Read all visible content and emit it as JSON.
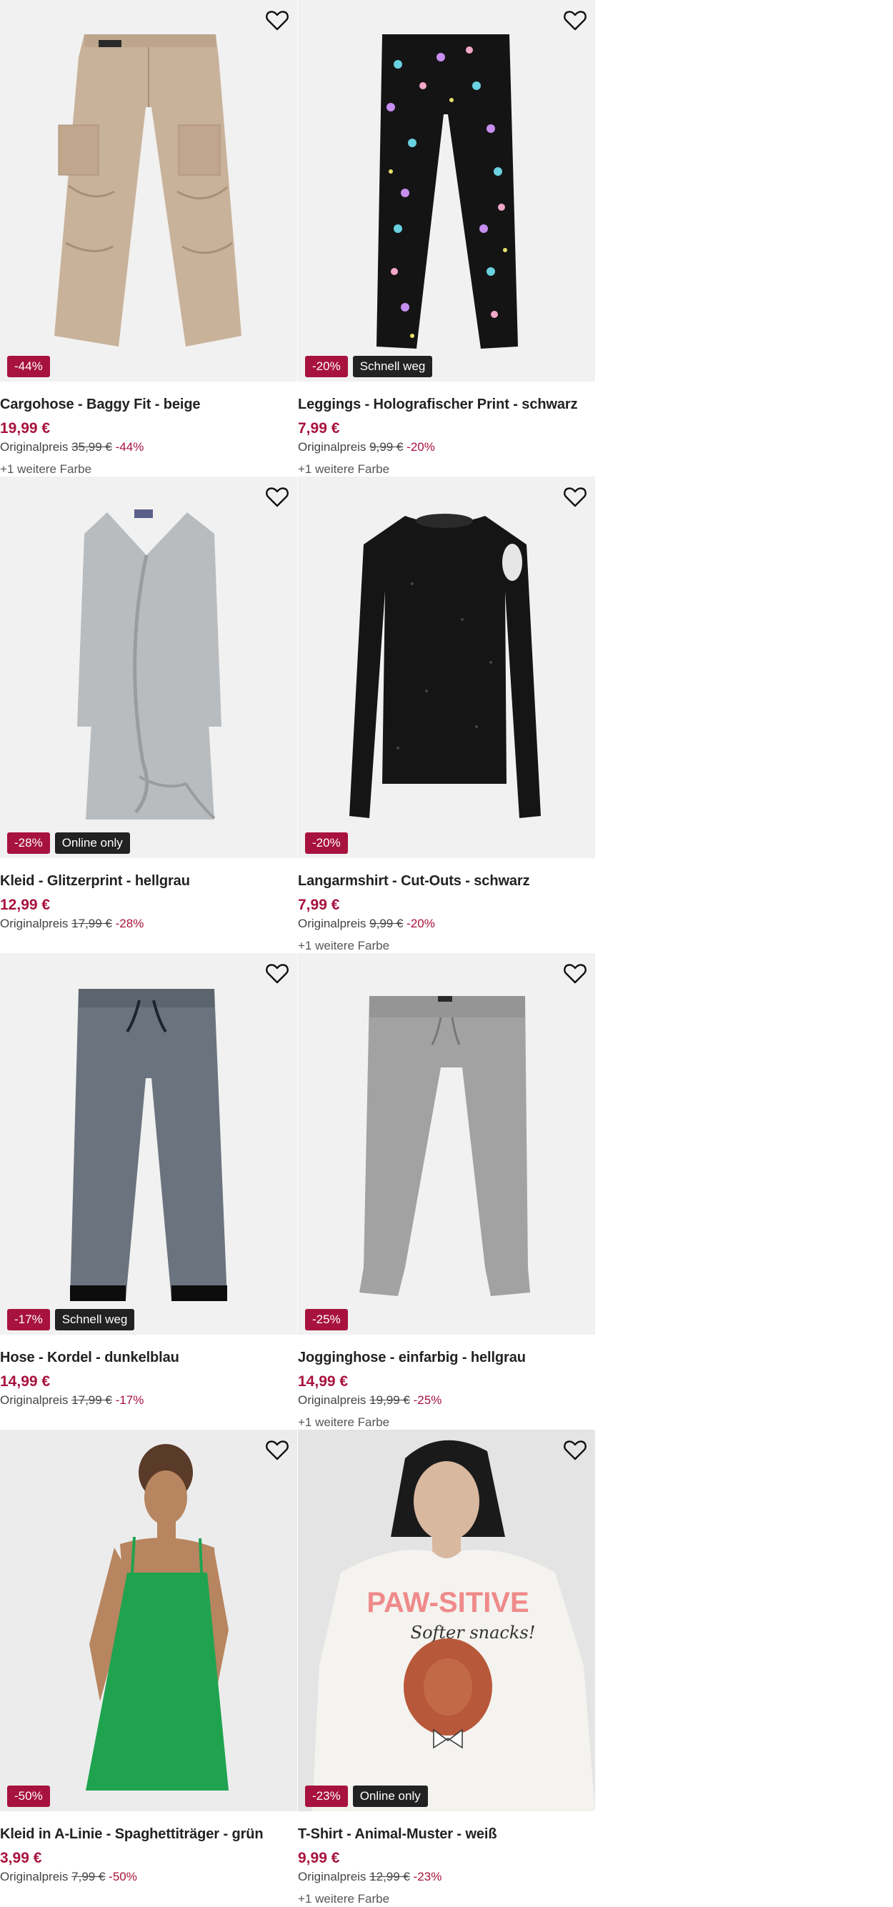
{
  "products": [
    {
      "title": "Cargohose - Baggy Fit - beige",
      "price": "19,99 €",
      "orig_label": "Originalpreis",
      "orig_price": "35,99 €",
      "orig_discount": "-44%",
      "badges": [
        "-44%"
      ],
      "more_colors": "+1 weitere Farbe",
      "art": "cargo-pants"
    },
    {
      "title": "Leggings - Holografischer Print - schwarz",
      "price": "7,99 €",
      "orig_label": "Originalpreis",
      "orig_price": "9,99 €",
      "orig_discount": "-20%",
      "badges": [
        "-20%",
        "Schnell weg"
      ],
      "more_colors": "+1 weitere Farbe",
      "art": "leggings"
    },
    {
      "title": "Kleid - Glitzerprint - hellgrau",
      "price": "12,99 €",
      "orig_label": "Originalpreis",
      "orig_price": "17,99 €",
      "orig_discount": "-28%",
      "badges": [
        "-28%",
        "Online only"
      ],
      "more_colors": "",
      "art": "wrap-dress"
    },
    {
      "title": "Langarmshirt - Cut-Outs - schwarz",
      "price": "7,99 €",
      "orig_label": "Originalpreis",
      "orig_price": "9,99 €",
      "orig_discount": "-20%",
      "badges": [
        "-20%"
      ],
      "more_colors": "+1 weitere Farbe",
      "art": "longsleeve"
    },
    {
      "title": "Hose - Kordel - dunkelblau",
      "price": "14,99 €",
      "orig_label": "Originalpreis",
      "orig_price": "17,99 €",
      "orig_discount": "-17%",
      "badges": [
        "-17%",
        "Schnell weg"
      ],
      "more_colors": "",
      "art": "lined-pants"
    },
    {
      "title": "Jogginghose - einfarbig - hellgrau",
      "price": "14,99 €",
      "orig_label": "Originalpreis",
      "orig_price": "19,99 €",
      "orig_discount": "-25%",
      "badges": [
        "-25%"
      ],
      "more_colors": "+1 weitere Farbe",
      "art": "joggers"
    },
    {
      "title": "Kleid in A-Linie - Spaghettiträger - grün",
      "price": "3,99 €",
      "orig_label": "Originalpreis",
      "orig_price": "7,99 €",
      "orig_discount": "-50%",
      "badges": [
        "-50%"
      ],
      "more_colors": "",
      "art": "green-dress"
    },
    {
      "title": "T-Shirt - Animal-Muster - weiß",
      "price": "9,99 €",
      "orig_label": "Originalpreis",
      "orig_price": "12,99 €",
      "orig_discount": "-23%",
      "badges": [
        "-23%",
        "Online only"
      ],
      "more_colors": "+1 weitere Farbe",
      "art": "tshirt",
      "print_text": {
        "line1": "PAW-SITIVE",
        "line2": "Softer snacks!"
      }
    }
  ],
  "icons": {
    "favorite": "heart-outline-icon"
  },
  "colors": {
    "sale": "#a8123e",
    "badge_dark": "#222222",
    "image_bg": "#f1f1f1"
  }
}
